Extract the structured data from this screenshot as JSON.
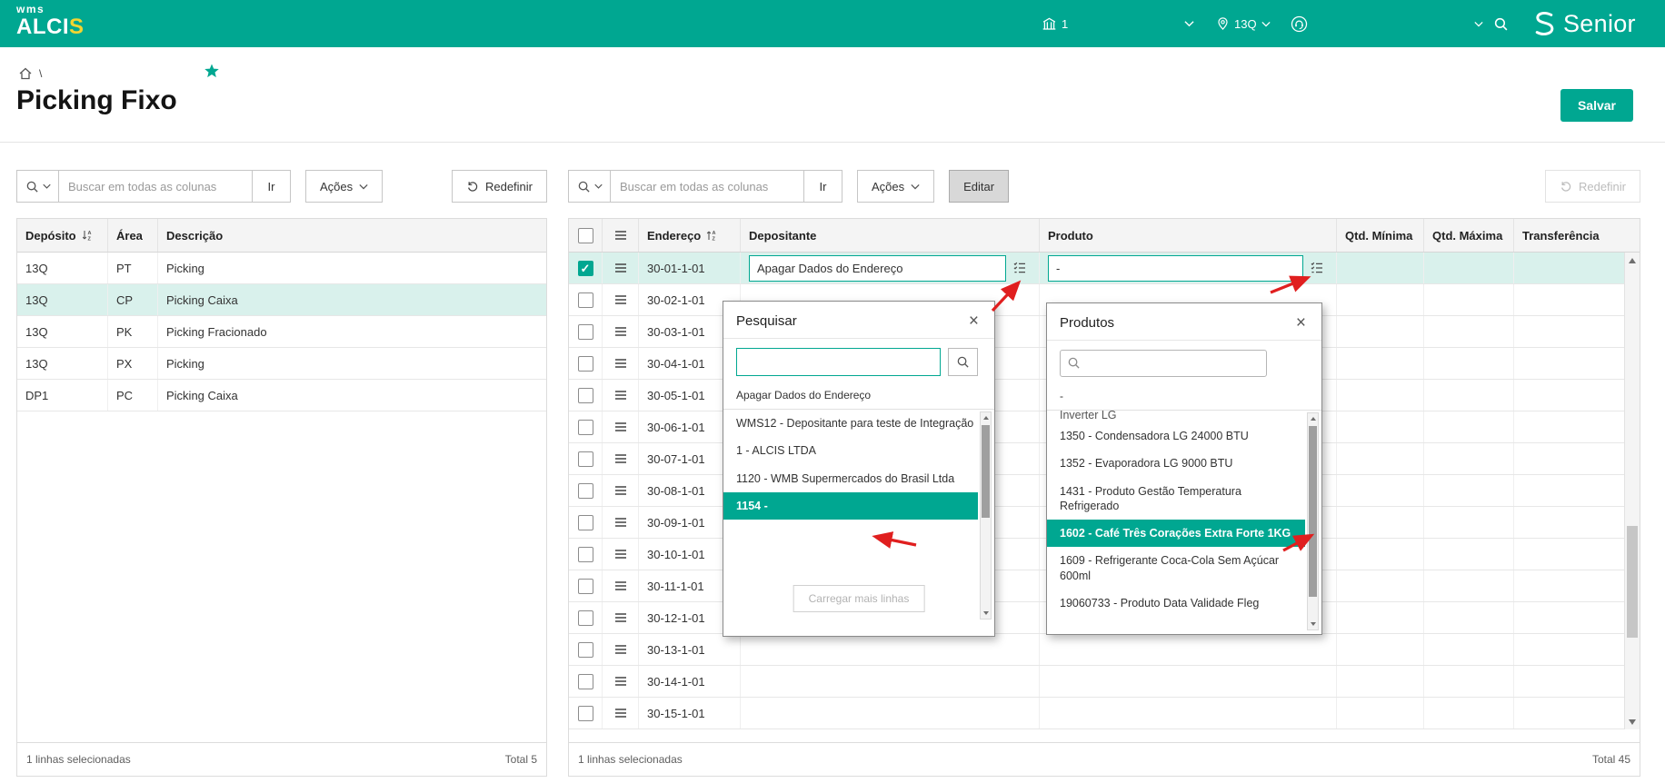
{
  "header": {
    "logo_top": "wms",
    "logo_main": "ALCI",
    "logo_accent": "S",
    "warehouse_badge": "1",
    "location": "13Q",
    "brand": "Senior"
  },
  "breadcrumb": {
    "separator": "\\"
  },
  "page": {
    "title": "Picking Fixo",
    "save_button": "Salvar"
  },
  "left_panel": {
    "search_placeholder": "Buscar em todas as colunas",
    "go_button": "Ir",
    "actions_button": "Ações",
    "reset_button": "Redefinir",
    "columns": [
      "Depósito",
      "Área",
      "Descrição"
    ],
    "rows": [
      {
        "deposito": "13Q",
        "area": "PT",
        "descricao": "Picking"
      },
      {
        "deposito": "13Q",
        "area": "CP",
        "descricao": "Picking Caixa",
        "selected": true
      },
      {
        "deposito": "13Q",
        "area": "PK",
        "descricao": "Picking Fracionado"
      },
      {
        "deposito": "13Q",
        "area": "PX",
        "descricao": "Picking"
      },
      {
        "deposito": "DP1",
        "area": "PC",
        "descricao": "Picking Caixa"
      }
    ],
    "footer_selected": "1 linhas selecionadas",
    "footer_total": "Total 5"
  },
  "right_panel": {
    "search_placeholder": "Buscar em todas as colunas",
    "go_button": "Ir",
    "actions_button": "Ações",
    "edit_button": "Editar",
    "reset_button": "Redefinir",
    "columns": [
      "Endereço",
      "Depositante",
      "Produto",
      "Qtd. Mínima",
      "Qtd. Máxima",
      "Transferência"
    ],
    "edit_row": {
      "endereco": "30-01-1-01",
      "depositante_value": "Apagar Dados do Endereço",
      "produto_value": "-"
    },
    "other_rows": [
      "30-02-1-01",
      "30-03-1-01",
      "30-04-1-01",
      "30-05-1-01",
      "30-06-1-01",
      "30-07-1-01",
      "30-08-1-01",
      "30-09-1-01",
      "30-10-1-01",
      "30-11-1-01",
      "30-12-1-01",
      "30-13-1-01",
      "30-14-1-01",
      "30-15-1-01"
    ],
    "footer_selected": "1 linhas selecionadas",
    "footer_total": "Total 45"
  },
  "pesquisar_popup": {
    "title": "Pesquisar",
    "search_value": "",
    "pinned_item": "Apagar Dados do Endereço",
    "items": [
      "WMS12 - Depositante para teste de Integração",
      "1 - ALCIS LTDA",
      "1120 - WMB Supermercados do Brasil Ltda",
      "1154 -"
    ],
    "selected_item": "1154 -",
    "load_more_button": "Carregar mais linhas"
  },
  "produtos_popup": {
    "title": "Produtos",
    "pinned_item": "-",
    "clipped_item": "Inverter LG",
    "items": [
      "1350 - Condensadora LG 24000 BTU",
      "1352 - Evaporadora LG 9000 BTU",
      "1431 - Produto Gestão Temperatura Refrigerado",
      "1602 - Café Três Corações Extra Forte 1KG",
      "1609 - Refrigerante Coca-Cola Sem Açúcar 600ml",
      "19060733 - Produto Data Validade Fleg"
    ],
    "selected_item": "1602 - Café Três Corações Extra Forte 1KG"
  },
  "colors": {
    "brand_teal": "#00a791",
    "selection_bg": "#d9f1ec",
    "arrow_red": "#e01f1f"
  }
}
